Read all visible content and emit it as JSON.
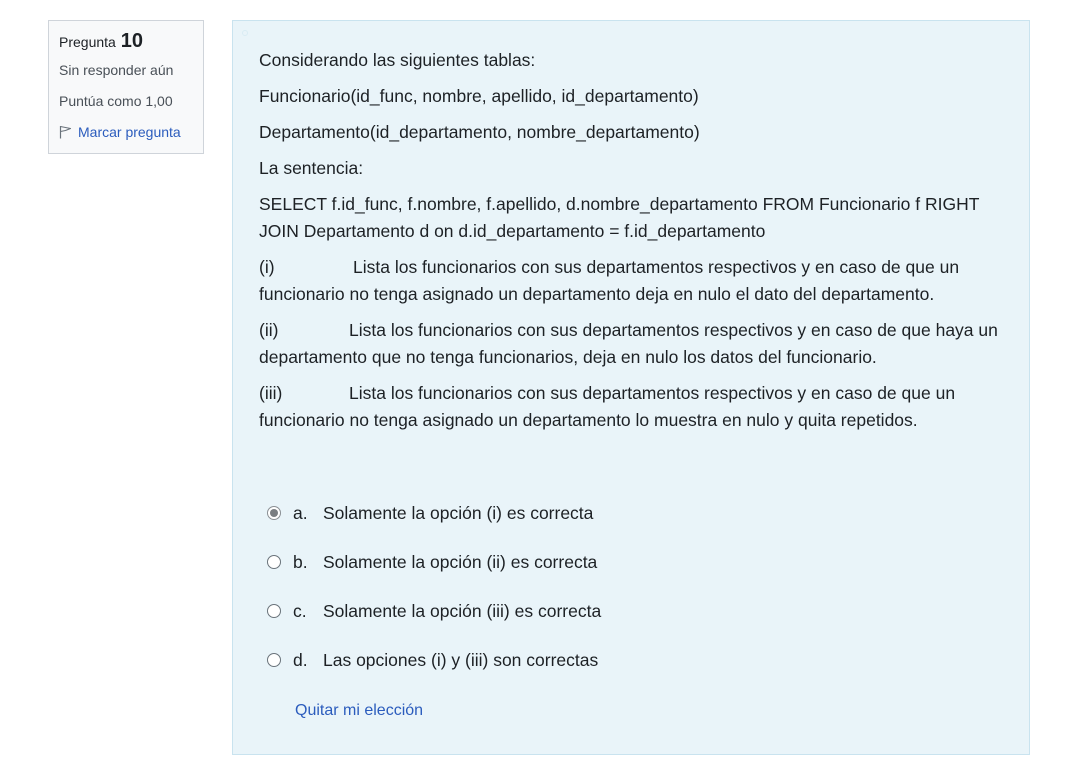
{
  "info": {
    "question_label": "Pregunta",
    "question_number": "10",
    "state": "Sin responder aún",
    "grade": "Puntúa como 1,00",
    "flag_label": "Marcar pregunta"
  },
  "question": {
    "intro": "Considerando las siguientes tablas:",
    "table1": "Funcionario(id_func, nombre, apellido, id_departamento)",
    "table2": "Departamento(id_departamento, nombre_departamento)",
    "sentence_label": "La sentencia:",
    "sql": "SELECT f.id_func, f.nombre, f.apellido, d.nombre_departamento FROM Funcionario f RIGHT JOIN Departamento d on d.id_departamento = f.id_departamento",
    "statements": [
      {
        "label": "(i)",
        "text": "Lista los funcionarios con sus departamentos respectivos y en caso de que un funcionario no tenga asignado un departamento deja en nulo el dato del departamento."
      },
      {
        "label": "(ii)",
        "text": "Lista los funcionarios con sus departamentos respectivos y en caso de que haya un departamento que no tenga funcionarios, deja en nulo los datos del funcionario."
      },
      {
        "label": "(iii)",
        "text": "Lista los funcionarios con sus departamentos respectivos y en caso de que un funcionario no tenga asignado un departamento lo muestra en nulo y quita repetidos."
      }
    ]
  },
  "answers": [
    {
      "letter": "a.",
      "text": "Solamente la opción (i) es correcta",
      "selected": true
    },
    {
      "letter": "b.",
      "text": "Solamente la opción (ii) es correcta",
      "selected": false
    },
    {
      "letter": "c.",
      "text": "Solamente la opción (iii) es correcta",
      "selected": false
    },
    {
      "letter": "d.",
      "text": "Las opciones (i) y (iii) son correctas",
      "selected": false
    }
  ],
  "clear_label": "Quitar mi elección",
  "colors": {
    "link": "#2b5cbd",
    "content_bg": "#e9f4f9",
    "info_bg": "#f8f9fa"
  }
}
